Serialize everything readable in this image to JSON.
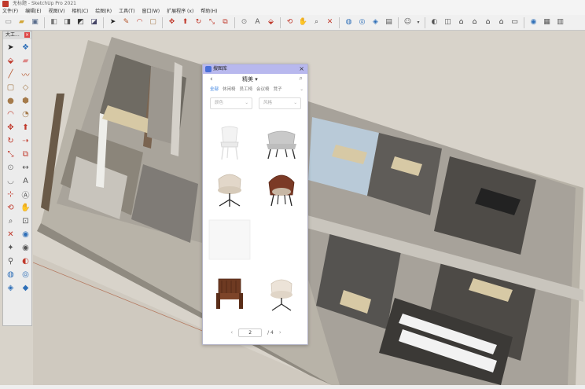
{
  "window": {
    "title": "无标题 - SketchUp Pro 2021"
  },
  "menu": [
    "文件(F)",
    "编辑(E)",
    "视图(V)",
    "相机(C)",
    "绘图(R)",
    "工具(T)",
    "窗口(W)",
    "扩展程序 (x)",
    "帮助(H)"
  ],
  "tool_palette": {
    "title": "大工..."
  },
  "library_panel": {
    "title": "搜图库",
    "category": "精美",
    "tabs": [
      "全部",
      "休闲椅",
      "员工椅",
      "会议椅",
      "凳子"
    ],
    "filter_color": "颜色",
    "filter_style": "风格",
    "items": [
      {
        "name": "white-plastic-chair-icon"
      },
      {
        "name": "grey-lounge-chair-icon"
      },
      {
        "name": "beige-swivel-chair-icon"
      },
      {
        "name": "brown-shell-chair-icon"
      },
      {
        "name": "blank-thumbnail"
      },
      {
        "name": "blank-thumbnail"
      },
      {
        "name": "wooden-lounge-chair-icon"
      },
      {
        "name": "cream-swivel-chair-icon"
      }
    ],
    "pager": {
      "current": "2",
      "total": "/ 4"
    }
  },
  "colors": {
    "panel_title_bg": "#b8b8ee",
    "accent_tab": "#2f7be0",
    "viewport_bg": "#d8d3ca"
  }
}
